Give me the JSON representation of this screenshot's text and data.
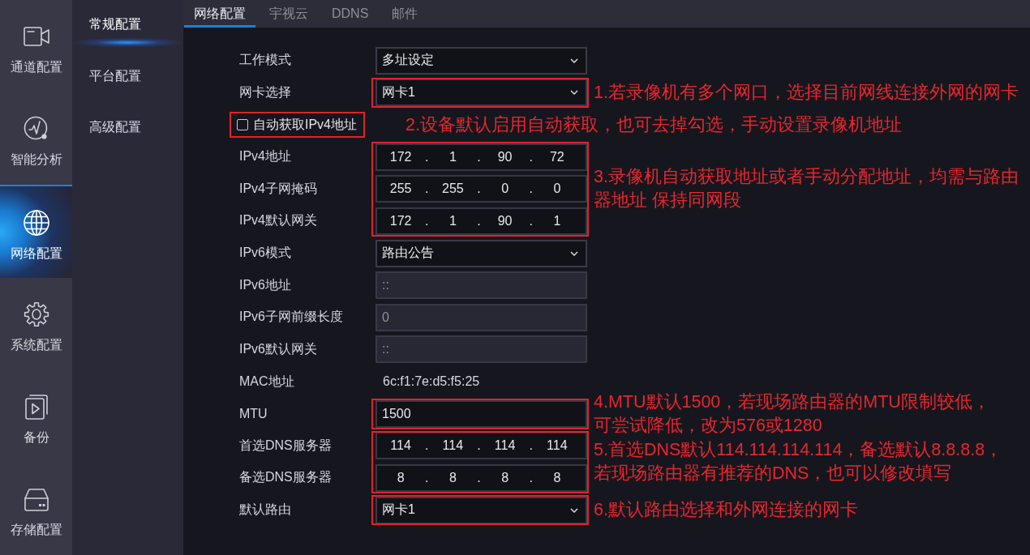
{
  "sidebar": {
    "items": [
      {
        "label": "通道配置",
        "selected": false
      },
      {
        "label": "智能分析",
        "selected": false
      },
      {
        "label": "网络配置",
        "selected": true
      },
      {
        "label": "系统配置",
        "selected": false
      },
      {
        "label": "备份",
        "selected": false
      },
      {
        "label": "存储配置",
        "selected": false
      }
    ]
  },
  "submenu": {
    "items": [
      {
        "label": "常规配置",
        "selected": true
      },
      {
        "label": "平台配置",
        "selected": false
      },
      {
        "label": "高级配置",
        "selected": false
      }
    ]
  },
  "tabs": [
    {
      "label": "网络配置",
      "selected": true
    },
    {
      "label": "宇视云",
      "selected": false
    },
    {
      "label": "DDNS",
      "selected": false
    },
    {
      "label": "邮件",
      "selected": false
    }
  ],
  "form": {
    "groups": [
      {
        "rows": [
          {
            "kind": "select",
            "label": "工作模式",
            "value": "多址设定"
          }
        ]
      },
      {
        "outlined": true,
        "note_lines": [
          "1.若录像机有多个网口，选择目前网线连接外网的网卡"
        ],
        "rows": [
          {
            "kind": "select",
            "label": "网卡选择",
            "value": "网卡1"
          }
        ]
      },
      {
        "outlined": true,
        "note_lines": [
          "2.设备默认启用自动获取，也可去掉勾选，手动设置录像机地址"
        ],
        "rows": [
          {
            "kind": "checkbox",
            "label": "自动获取IPv4地址",
            "checked": false
          }
        ]
      },
      {
        "outlined": true,
        "note_lines": [
          "3.录像机自动获取地址或者手动分配地址，均需与路由",
          "器地址 保持同网段"
        ],
        "rows": [
          {
            "kind": "ip",
            "label": "IPv4地址",
            "octets": [
              "172",
              "1",
              "90",
              "72"
            ],
            "dots": [
              ".",
              ".",
              "."
            ]
          },
          {
            "kind": "ip",
            "label": "IPv4子网掩码",
            "octets": [
              "255",
              "255",
              "0",
              "0"
            ],
            "dots": [
              ".",
              ".",
              "."
            ]
          },
          {
            "kind": "ip",
            "label": "IPv4默认网关",
            "octets": [
              "172",
              "1",
              "90",
              "1"
            ],
            "dots": [
              ".",
              ".",
              "."
            ]
          }
        ]
      },
      {
        "rows": [
          {
            "kind": "select",
            "label": "IPv6模式",
            "value": "路由公告"
          },
          {
            "kind": "input",
            "label": "IPv6地址",
            "value": "::",
            "disabled": true
          },
          {
            "kind": "input",
            "label": "IPv6子网前缀长度",
            "value": "0",
            "disabled": true
          },
          {
            "kind": "input",
            "label": "IPv6默认网关",
            "value": "::",
            "disabled": true
          },
          {
            "kind": "text",
            "label": "MAC地址",
            "value": "6c:f1:7e:d5:f5:25"
          }
        ]
      },
      {
        "outlined": true,
        "note_lines": [
          "4.MTU默认1500，若现场路由器的MTU限制较低，",
          "可尝试降低，改为576或1280"
        ],
        "rows": [
          {
            "kind": "input",
            "label": "MTU",
            "value": "1500",
            "disabled": false
          }
        ]
      },
      {
        "outlined": true,
        "note_lines": [
          "5.首选DNS默认114.114.114.114，备选默认8.8.8.8，",
          "若现场路由器有推荐的DNS，也可以修改填写"
        ],
        "rows": [
          {
            "kind": "ip",
            "label": "首选DNS服务器",
            "octets": [
              "114",
              "114",
              "114",
              "114"
            ],
            "dots": [
              ".",
              ".",
              "."
            ]
          },
          {
            "kind": "ip",
            "label": "备选DNS服务器",
            "octets": [
              "8",
              "8",
              "8",
              "8"
            ],
            "dots": [
              ".",
              ".",
              "."
            ]
          }
        ]
      },
      {
        "outlined": true,
        "note_lines": [
          "6.默认路由选择和外网连接的网卡"
        ],
        "rows": [
          {
            "kind": "select",
            "label": "默认路由",
            "value": "网卡1"
          }
        ]
      }
    ]
  }
}
